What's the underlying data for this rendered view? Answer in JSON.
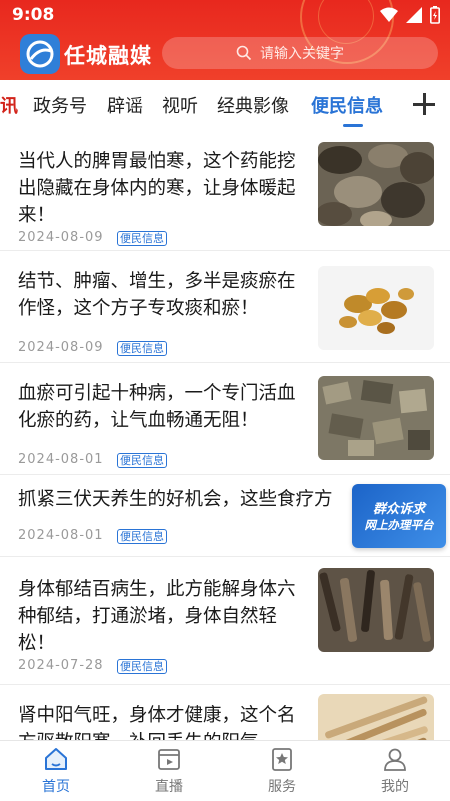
{
  "status_bar": {
    "time": "9:08"
  },
  "header": {
    "app_name": "任城融媒",
    "search_placeholder": "请输入关键字"
  },
  "tabs": [
    {
      "label": "资讯"
    },
    {
      "label": "政务号"
    },
    {
      "label": "辟谣"
    },
    {
      "label": "视听"
    },
    {
      "label": "经典影像"
    },
    {
      "label": "便民信息"
    }
  ],
  "articles": [
    {
      "title": "当代人的脾胃最怕寒，这个药能挖出隐藏在身体内的寒，让身体暖起来！",
      "date": "2024-08-09",
      "tag": "便民信息"
    },
    {
      "title": "结节、肿瘤、增生，多半是痰瘀在作怪，这个方子专攻痰和瘀！",
      "date": "2024-08-09",
      "tag": "便民信息"
    },
    {
      "title": "血瘀可引起十种病，一个专门活血化瘀的药，让气血畅通无阻！",
      "date": "2024-08-01",
      "tag": "便民信息"
    },
    {
      "title": "抓紧三伏天养生的好机会，这些食疗方",
      "date": "2024-08-01",
      "tag": "便民信息"
    },
    {
      "title": "身体郁结百病生，此方能解身体六种郁结，打通淤堵，身体自然轻松！",
      "date": "2024-07-28",
      "tag": "便民信息"
    },
    {
      "title": "肾中阳气旺，身体才健康，这个名方驱散阳寒，补回丢失的阳气",
      "date": "",
      "tag": ""
    }
  ],
  "floating_banner": {
    "line1": "群众诉求",
    "line2": "网上办理平台"
  },
  "bottom_nav": [
    {
      "label": "首页"
    },
    {
      "label": "直播"
    },
    {
      "label": "服务"
    },
    {
      "label": "我的"
    }
  ],
  "colors": {
    "header_red": "#e8281e",
    "accent_blue": "#2a74d6"
  }
}
